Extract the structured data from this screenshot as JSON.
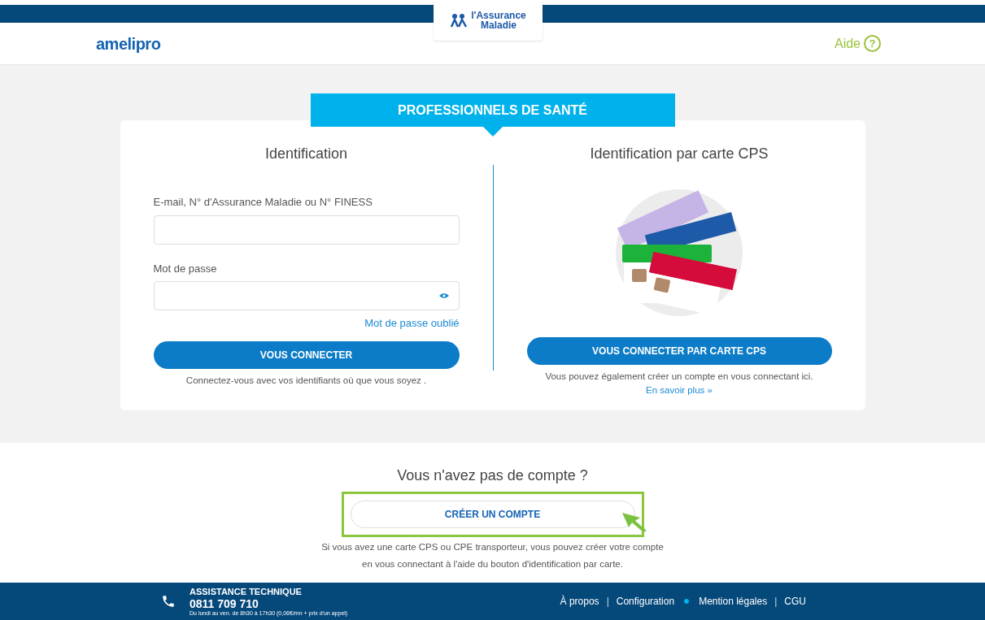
{
  "header": {
    "brand": "amelipro",
    "logo_line1": "l'Assurance",
    "logo_line2": "Maladie",
    "help": "Aide",
    "help_icon": "?"
  },
  "banner": "PROFESSIONNELS DE SANTÉ",
  "login": {
    "title": "Identification",
    "fields": [
      {
        "label": "E-mail, N° d'Assurance Maladie ou N° FINESS",
        "kind": "text"
      },
      {
        "label": "Mot de passe",
        "kind": "password"
      }
    ],
    "forgot": "Mot de passe oublié",
    "button": "VOUS CONNECTER",
    "note": "Connectez-vous avec vos identifiants où que vous soyez ."
  },
  "card_login": {
    "title": "Identification par carte CPS",
    "button": "VOUS CONNECTER PAR CARTE CPS",
    "note": "Vous pouvez également créer un compte en vous connectant ici.",
    "link": "En savoir plus »"
  },
  "signup": {
    "title": "Vous n'avez pas de compte ?",
    "button": "CRÉER UN COMPTE",
    "highlighted": true,
    "note_line1": "Si vous avez une carte CPS ou CPE transporteur, vous pouvez créer votre compte",
    "note_line2": "en vous connectant à l'aide du bouton d'identification par carte."
  },
  "footer": {
    "title": "ASSISTANCE TECHNIQUE",
    "phone": "0811 709 710",
    "hours": "Du lundi au ven. de 8h30 à 17h30 (0,06€/mn + prix d'un appel)",
    "items": [
      {
        "kind": "link",
        "label": "À propos"
      },
      {
        "kind": "separator",
        "label": "|"
      },
      {
        "kind": "link",
        "label": "Configuration"
      },
      {
        "kind": "dot"
      },
      {
        "kind": "link",
        "label": "Mention légales"
      },
      {
        "kind": "separator",
        "label": "|"
      },
      {
        "kind": "link",
        "label": "CGU"
      }
    ]
  }
}
